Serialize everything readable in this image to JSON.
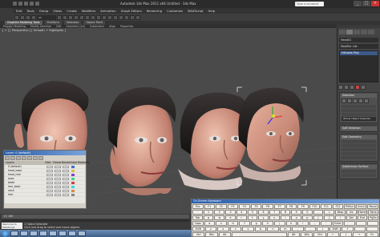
{
  "app": {
    "logo_letter": "3",
    "window_title": "Autodesk 3ds Max 2011 x64   Untitled - 3ds Max",
    "help_search_placeholder": "Type a keyword"
  },
  "menubar": [
    "Edit",
    "Tools",
    "Group",
    "Views",
    "Create",
    "Modifiers",
    "Animation",
    "Graph Editors",
    "Rendering",
    "Customize",
    "MAXScript",
    "Help"
  ],
  "toolbar": {
    "selection_filter": "All"
  },
  "ribbon": {
    "tabs": [
      "Graphite Modeling Tools",
      "Freeform",
      "Selection",
      "Object Paint"
    ],
    "sub_tabs": [
      "Polygon Modeling",
      "Modify Selection",
      "Edit",
      "Geometry (All)",
      "Subdivision",
      "Align",
      "Properties"
    ]
  },
  "viewport": {
    "label": "[ + ] [ Perspective ] [ Smooth + Highlights ]"
  },
  "command_panel": {
    "object_name": "Head01",
    "modifier_list": "Modifier List",
    "stack_item": "Editable Poly",
    "rollouts": [
      "Selection",
      "Soft Selection",
      "Edit Geometry",
      "Subdivision Surface"
    ],
    "whole_object": "Whole Object Selected"
  },
  "layer_manager": {
    "title": "Layer: 0 (default)",
    "columns": [
      "Layers",
      "Hide",
      "Freeze",
      "Render",
      "Color",
      "Radiosity"
    ],
    "layers": [
      {
        "name": "0 (default)",
        "color": "#3a6fd8"
      },
      {
        "name": "head_base",
        "color": "#d8c23a"
      },
      {
        "name": "head_mid",
        "color": "#8a3ad8"
      },
      {
        "name": "eyes",
        "color": "#3ad88a"
      },
      {
        "name": "teeth",
        "color": "#d83a3a"
      },
      {
        "name": "hair_back",
        "color": "#3ad8d8"
      },
      {
        "name": "neck",
        "color": "#d8883a"
      },
      {
        "name": "hair",
        "color": "#888888"
      }
    ]
  },
  "keyboard": {
    "title": "On-Screen Keyboard",
    "rows": [
      [
        "Esc",
        "F1",
        "F2",
        "F3",
        "F4",
        "F5",
        "F6",
        "F7",
        "F8",
        "F9",
        "F10",
        "F11",
        "F12",
        "PrtScn",
        "ScrLk",
        "Pause"
      ],
      [
        "`",
        "1",
        "2",
        "3",
        "4",
        "5",
        "6",
        "7",
        "8",
        "9",
        "0",
        "-",
        "=",
        "Bksp",
        "Ins",
        "Home",
        "PgUp"
      ],
      [
        "Tab",
        "q",
        "w",
        "e",
        "r",
        "t",
        "y",
        "u",
        "i",
        "o",
        "p",
        "[",
        "]",
        "\\",
        "Del",
        "End",
        "PgDn"
      ],
      [
        "Caps",
        "a",
        "s",
        "d",
        "f",
        "g",
        "h",
        "j",
        "k",
        "l",
        ";",
        "'",
        "Enter",
        "",
        "",
        ""
      ],
      [
        "Shift",
        "z",
        "x",
        "c",
        "v",
        "b",
        "n",
        "m",
        ",",
        ".",
        "/",
        "Shift",
        "↑",
        "",
        ""
      ],
      [
        "Ctrl",
        "Win",
        "Alt",
        "",
        "Alt",
        "Win",
        "Ctrl",
        "←",
        "↓",
        "→",
        "Fn"
      ]
    ]
  },
  "status": {
    "time_slider": "0 / 100",
    "selection": "1 Object Selected",
    "prompt": "Click and drag to select and move objects",
    "maxscript": "Welcome to MAXScript"
  },
  "taskbar": {
    "items": [
      "start",
      "explorer",
      "media",
      "folder",
      "3dsmax",
      "photoshop",
      "browser",
      "mail",
      "app"
    ]
  }
}
